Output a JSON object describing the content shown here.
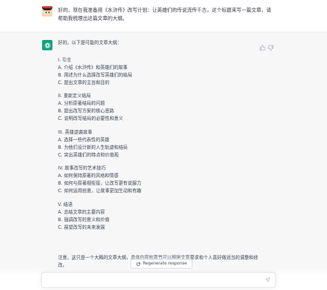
{
  "conversation": {
    "user_message": {
      "text": "好的，现在我准备用《水浒传》改写计划：让英雄们的传说流传千古，这个标题来写一篇文章，请帮助我梳理出这篇文章的大纲。"
    },
    "assistant_message": {
      "intro": "好的，以下是可能的文章大纲：",
      "outline": [
        {
          "heading": "I. 引言",
          "items": [
            "A. 介绍《水浒传》和英雄们的故事",
            "B. 简述为什么选择改写英雄们的结局",
            "C. 提出文章的主旨和目的"
          ]
        },
        {
          "heading": "II. 重新定义结局",
          "items": [
            "A. 分析原著结局的问题",
            "B. 提出改写方案的核心思路",
            "C. 说明改写结局的必要性和意义"
          ]
        },
        {
          "heading": "III. 英雄逆袭故事",
          "items": [
            "A. 选择一些代表性的英雄",
            "B. 为他们设计新的人生轨迹和结局",
            "C. 突出英雄们的特点和价值观"
          ]
        },
        {
          "heading": "IV. 故事改写的艺术技巧",
          "items": [
            "A. 如何保持原著的风格和情感",
            "B. 如何与原著相衔接，让改写更有说服力",
            "C. 如何运用创意，让故事更加生动和有趣"
          ]
        },
        {
          "heading": "V. 结语",
          "items": [
            "A. 总结文章的主要内容",
            "B. 强调改写的意义和价值",
            "C. 展望改写的未来发展"
          ]
        }
      ],
      "outro": "注意，这只是一个大概的文章大纲，具体内容和章节可以根据文章要求和个人喜好做适当的调整和修改。"
    }
  },
  "controls": {
    "regenerate_label": "Regenerate response",
    "regenerate_icon": "refresh-icon",
    "send_icon": "paper-plane-icon",
    "thumbs_up_icon": "thumbs-up-icon",
    "thumbs_down_icon": "thumbs-down-icon"
  },
  "colors": {
    "assistant_avatar": "#10a37f",
    "assistant_bg": "#f7f7f8"
  }
}
